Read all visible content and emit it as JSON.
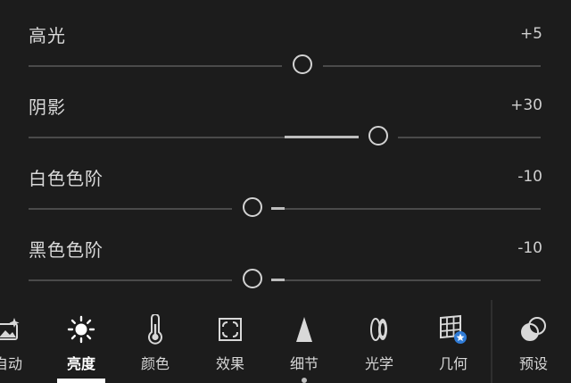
{
  "sliders": [
    {
      "label": "高光",
      "value": "+5"
    },
    {
      "label": "阴影",
      "value": "+30"
    },
    {
      "label": "白色色阶",
      "value": "-10"
    },
    {
      "label": "黑色色阶",
      "value": "-10"
    }
  ],
  "toolbar": {
    "items": [
      {
        "label": "自动",
        "icon": "auto-image-icon"
      },
      {
        "label": "亮度",
        "icon": "sun-icon",
        "active": true
      },
      {
        "label": "颜色",
        "icon": "thermometer-icon"
      },
      {
        "label": "效果",
        "icon": "vignette-frame-icon"
      },
      {
        "label": "细节",
        "icon": "triangle-icon"
      },
      {
        "label": "光学",
        "icon": "lens-icon"
      },
      {
        "label": "几何",
        "icon": "grid-star-icon"
      },
      {
        "label": "预设",
        "icon": "presets-circles-icon"
      }
    ]
  },
  "colors": {
    "background": "#1c1c1c",
    "track": "#4a4a4a",
    "fill": "#bdbdbd",
    "thumb": "#d2d2d2",
    "accent": "#2f7bd6"
  }
}
